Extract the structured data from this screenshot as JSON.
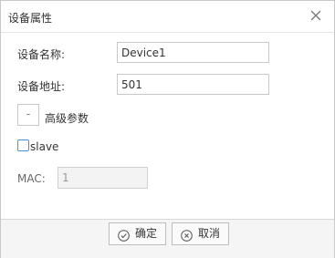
{
  "dialog": {
    "title": "设备属性",
    "close_icon": "close-icon"
  },
  "form": {
    "device_name_label": "设备名称:",
    "device_name_value": "Device1",
    "device_address_label": "设备地址:",
    "device_address_value": "501",
    "advanced_toggle": "-",
    "advanced_label": "高级参数",
    "slave_label": "slave",
    "slave_checked": false,
    "mac_label": "MAC:",
    "mac_value": "1"
  },
  "footer": {
    "ok_label": "确定",
    "ok_icon": "check-circle-icon",
    "cancel_label": "取消",
    "cancel_icon": "x-circle-icon"
  },
  "colors": {
    "checkbox_border": "#4a8fd6",
    "icon_stroke": "#555555"
  }
}
